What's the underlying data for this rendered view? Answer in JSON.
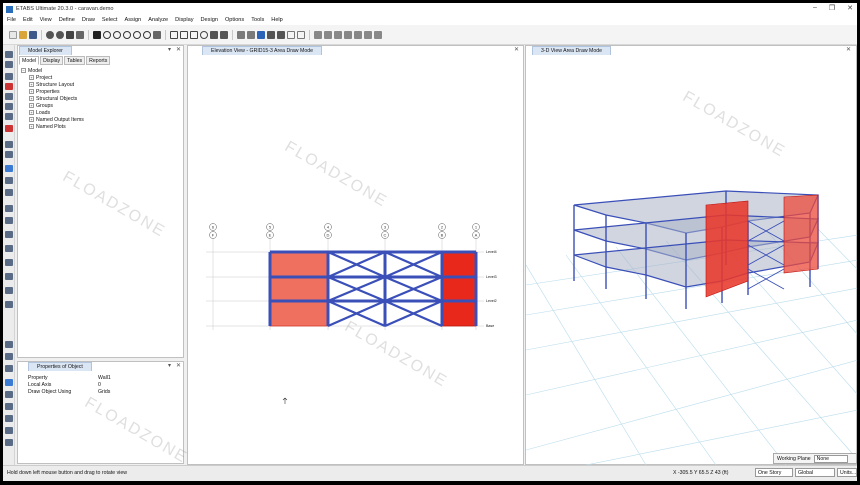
{
  "window": {
    "title": "ETABS Ultimate 20.3.0 - caravan.demo"
  },
  "menu": [
    "File",
    "Edit",
    "View",
    "Define",
    "Draw",
    "Select",
    "Assign",
    "Analyze",
    "Display",
    "Design",
    "Options",
    "Tools",
    "Help"
  ],
  "toolbar": {
    "icons": [
      "new-icon",
      "open-icon",
      "save-icon",
      "undo-icon",
      "redo-icon",
      "pen-icon",
      "lock-icon",
      "run-icon",
      "zoom-in-icon",
      "zoom-out-icon",
      "zoom-window-icon",
      "pan-icon",
      "refresh-icon",
      "3d-view-icon",
      "plan-view-icon",
      "elevation-icon",
      "rotate-icon",
      "up-icon",
      "down-icon",
      "object-shrink-icon",
      "display-icon",
      "select-icon",
      "draw-frame-icon",
      "draw-wall-icon",
      "display-options-icon",
      "grid-icon"
    ]
  },
  "explorer": {
    "title": "Model Explorer",
    "tabs": [
      "Model",
      "Display",
      "Tables",
      "Reports"
    ],
    "root": "Model",
    "items": [
      "Project",
      "Structure Layout",
      "Properties",
      "Structural Objects",
      "Groups",
      "Loads",
      "Named Output Items",
      "Named Plots"
    ]
  },
  "props": {
    "title": "Properties of Object",
    "rows": [
      {
        "key": "Property",
        "value": "Wall1"
      },
      {
        "key": "Local Axis",
        "value": "0"
      },
      {
        "key": "Draw Object Using",
        "value": "Grids"
      }
    ]
  },
  "elevation": {
    "tab": "Elevation View - GRID15-3  Area Draw Mode",
    "grid_labels": [
      "F",
      "E",
      "D",
      "C",
      "B",
      "A"
    ],
    "grid_numbers": [
      "6",
      "5",
      "4",
      "3",
      "2",
      "1"
    ],
    "story_labels": [
      "Level4",
      "Level3",
      "Level2",
      "Base"
    ]
  },
  "view3d": {
    "tab": "3-D View  Area Draw Mode"
  },
  "watermark": "FLOADZONE",
  "status": {
    "message": "Hold down left mouse button and drag to rotate view",
    "coords": "X -305.5  Y 65.5  Z 43 (ft)",
    "story": "One Story",
    "coord_system": "Global",
    "units": "Units...",
    "working_plane_label": "Working Plane",
    "working_plane_value": "None"
  },
  "colors": {
    "wall_fill": "#f0442a",
    "frame": "#3a4fb8"
  }
}
